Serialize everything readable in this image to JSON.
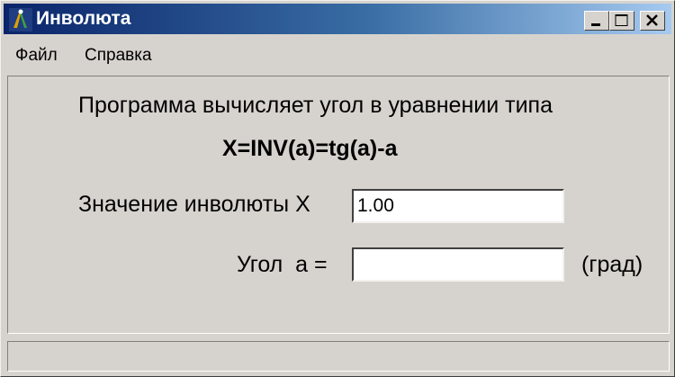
{
  "window": {
    "title": "Инволюта",
    "icon": "compass-app-icon"
  },
  "menu": {
    "items": [
      "Файл",
      "Справка"
    ]
  },
  "main": {
    "description": "Программа вычисляет угол в уравнении типа",
    "formula": "X=INV(a)=tg(a)-a",
    "involute_label": "Значение инволюты X",
    "involute_value": "1.00",
    "angle_label": "Угол  a =",
    "angle_value": "",
    "angle_unit": "(град)"
  },
  "colors": {
    "titlebar_start": "#0a246a",
    "titlebar_end": "#a6caf0",
    "face": "#d6d3ce"
  }
}
